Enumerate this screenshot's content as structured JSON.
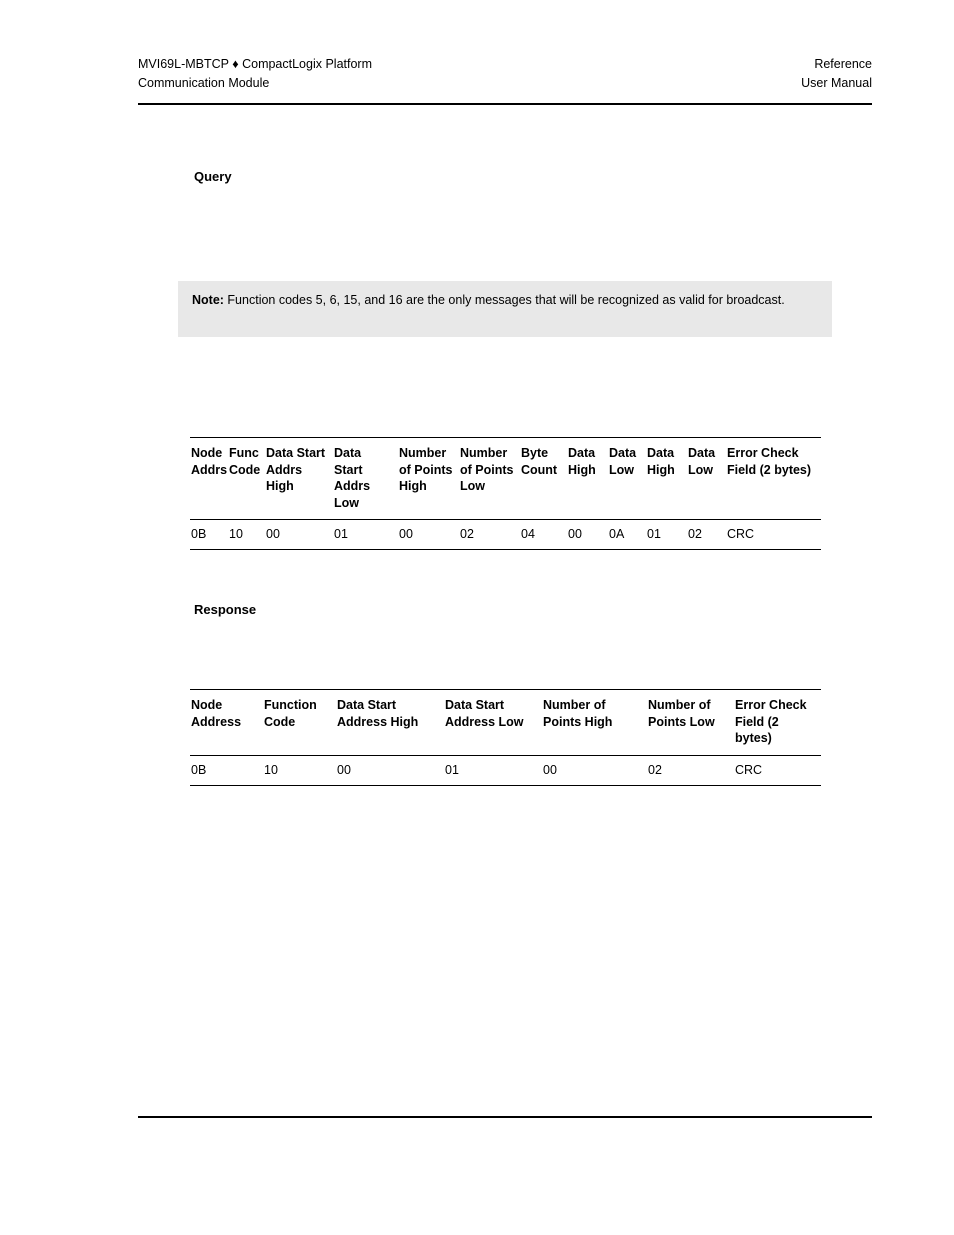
{
  "header": {
    "left_line1": "MVI69L-MBTCP ♦ CompactLogix Platform",
    "left_line2": "Communication Module",
    "right_line1": "Reference",
    "right_line2": "User Manual"
  },
  "sections": {
    "query_heading": "Query",
    "response_heading": "Response"
  },
  "note": {
    "label": "Note:",
    "body": " Function codes 5, 6, 15, and 16 are the only messages that will be recognized as valid for broadcast."
  },
  "query_table": {
    "headers": [
      "Node Addrs",
      "Func Code",
      "Data Start Addrs High",
      "Data Start Addrs Low",
      "Number of Points High",
      "Number of Points Low",
      "Byte Count",
      "Data High",
      "Data Low",
      "Data High",
      "Data Low",
      "Error Check Field (2 bytes)"
    ],
    "rows": [
      [
        "0B",
        "10",
        "00",
        "01",
        "00",
        "02",
        "04",
        "00",
        "0A",
        "01",
        "02",
        "CRC"
      ]
    ]
  },
  "response_table": {
    "headers": [
      "Node Address",
      "Function Code",
      "Data Start Address High",
      "Data Start Address Low",
      "Number of Points High",
      "Number of Points Low",
      "Error Check Field (2 bytes)"
    ],
    "rows": [
      [
        "0B",
        "10",
        "00",
        "01",
        "00",
        "02",
        "CRC"
      ]
    ]
  }
}
